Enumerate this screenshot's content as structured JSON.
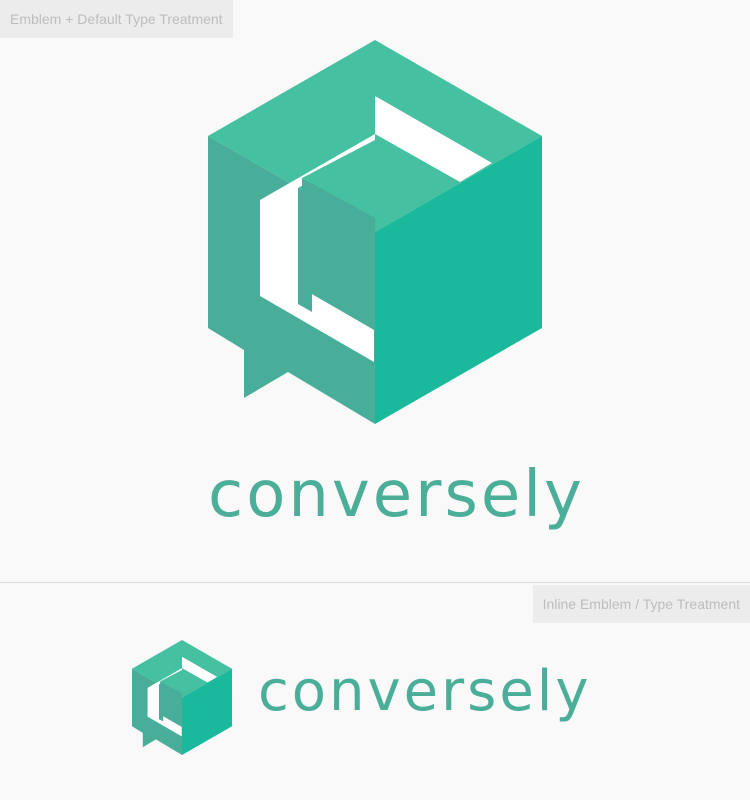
{
  "sections": {
    "primary": {
      "caption": "Emblem + Default Type Treatment",
      "wordmark": "conversely"
    },
    "inline": {
      "caption": "Inline Emblem / Type Treatment",
      "wordmark": "conversely"
    }
  },
  "emblem": {
    "icon": "cube-speech-bubble-logo",
    "colors": {
      "top_face": "#45c0a1",
      "left_face": "#48ae9a",
      "right_face": "#1bb99c",
      "cutout": "#ffffff"
    }
  },
  "brand_color": "#4bae98"
}
